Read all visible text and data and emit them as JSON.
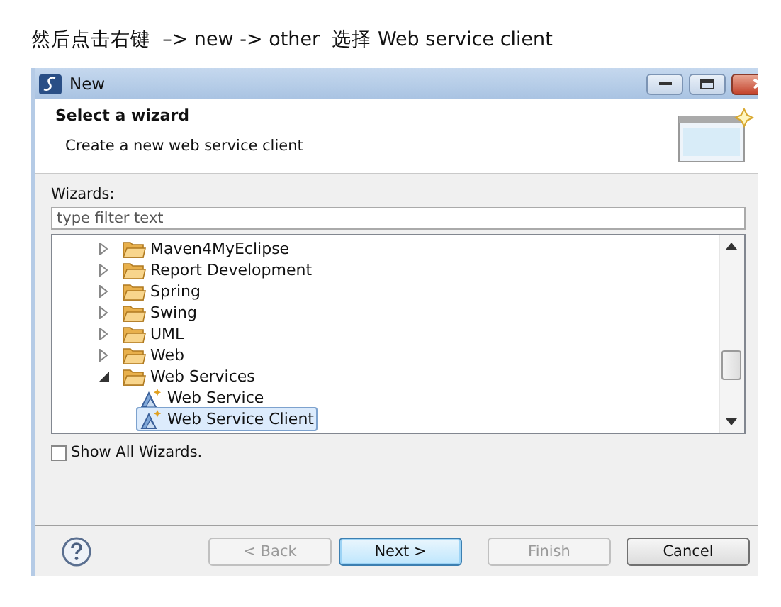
{
  "caption": "然后点击右键  –> new -> other  选择 Web service client",
  "window": {
    "title": "New"
  },
  "header": {
    "title": "Select a wizard",
    "description": "Create a new web service client"
  },
  "wizards_label": {
    "text": "Wizards:"
  },
  "filter": {
    "placeholder": "type filter text"
  },
  "tree": [
    {
      "label": "Maven4MyEclipse",
      "kind": "folder",
      "expanded": false,
      "selected": false
    },
    {
      "label": "Report Development",
      "kind": "folder",
      "expanded": false,
      "selected": false
    },
    {
      "label": "Spring",
      "kind": "folder",
      "expanded": false,
      "selected": false
    },
    {
      "label": "Swing",
      "kind": "folder",
      "expanded": false,
      "selected": false
    },
    {
      "label": "UML",
      "kind": "folder",
      "expanded": false,
      "selected": false
    },
    {
      "label": "Web",
      "kind": "folder",
      "expanded": false,
      "selected": false
    },
    {
      "label": "Web Services",
      "kind": "folder",
      "expanded": true,
      "selected": false,
      "children": [
        {
          "label": "Web Service",
          "kind": "wizard",
          "selected": false
        },
        {
          "label": "Web Service Client",
          "kind": "wizard",
          "selected": true
        }
      ]
    }
  ],
  "show_all": {
    "label": "Show All Wizards.",
    "checked": false
  },
  "buttons": [
    {
      "label": "< Back",
      "disabled": true,
      "default": false
    },
    {
      "label": "Next >",
      "disabled": false,
      "default": true
    },
    {
      "label": "Finish",
      "disabled": true,
      "default": false
    },
    {
      "label": "Cancel",
      "disabled": false,
      "default": false
    }
  ]
}
